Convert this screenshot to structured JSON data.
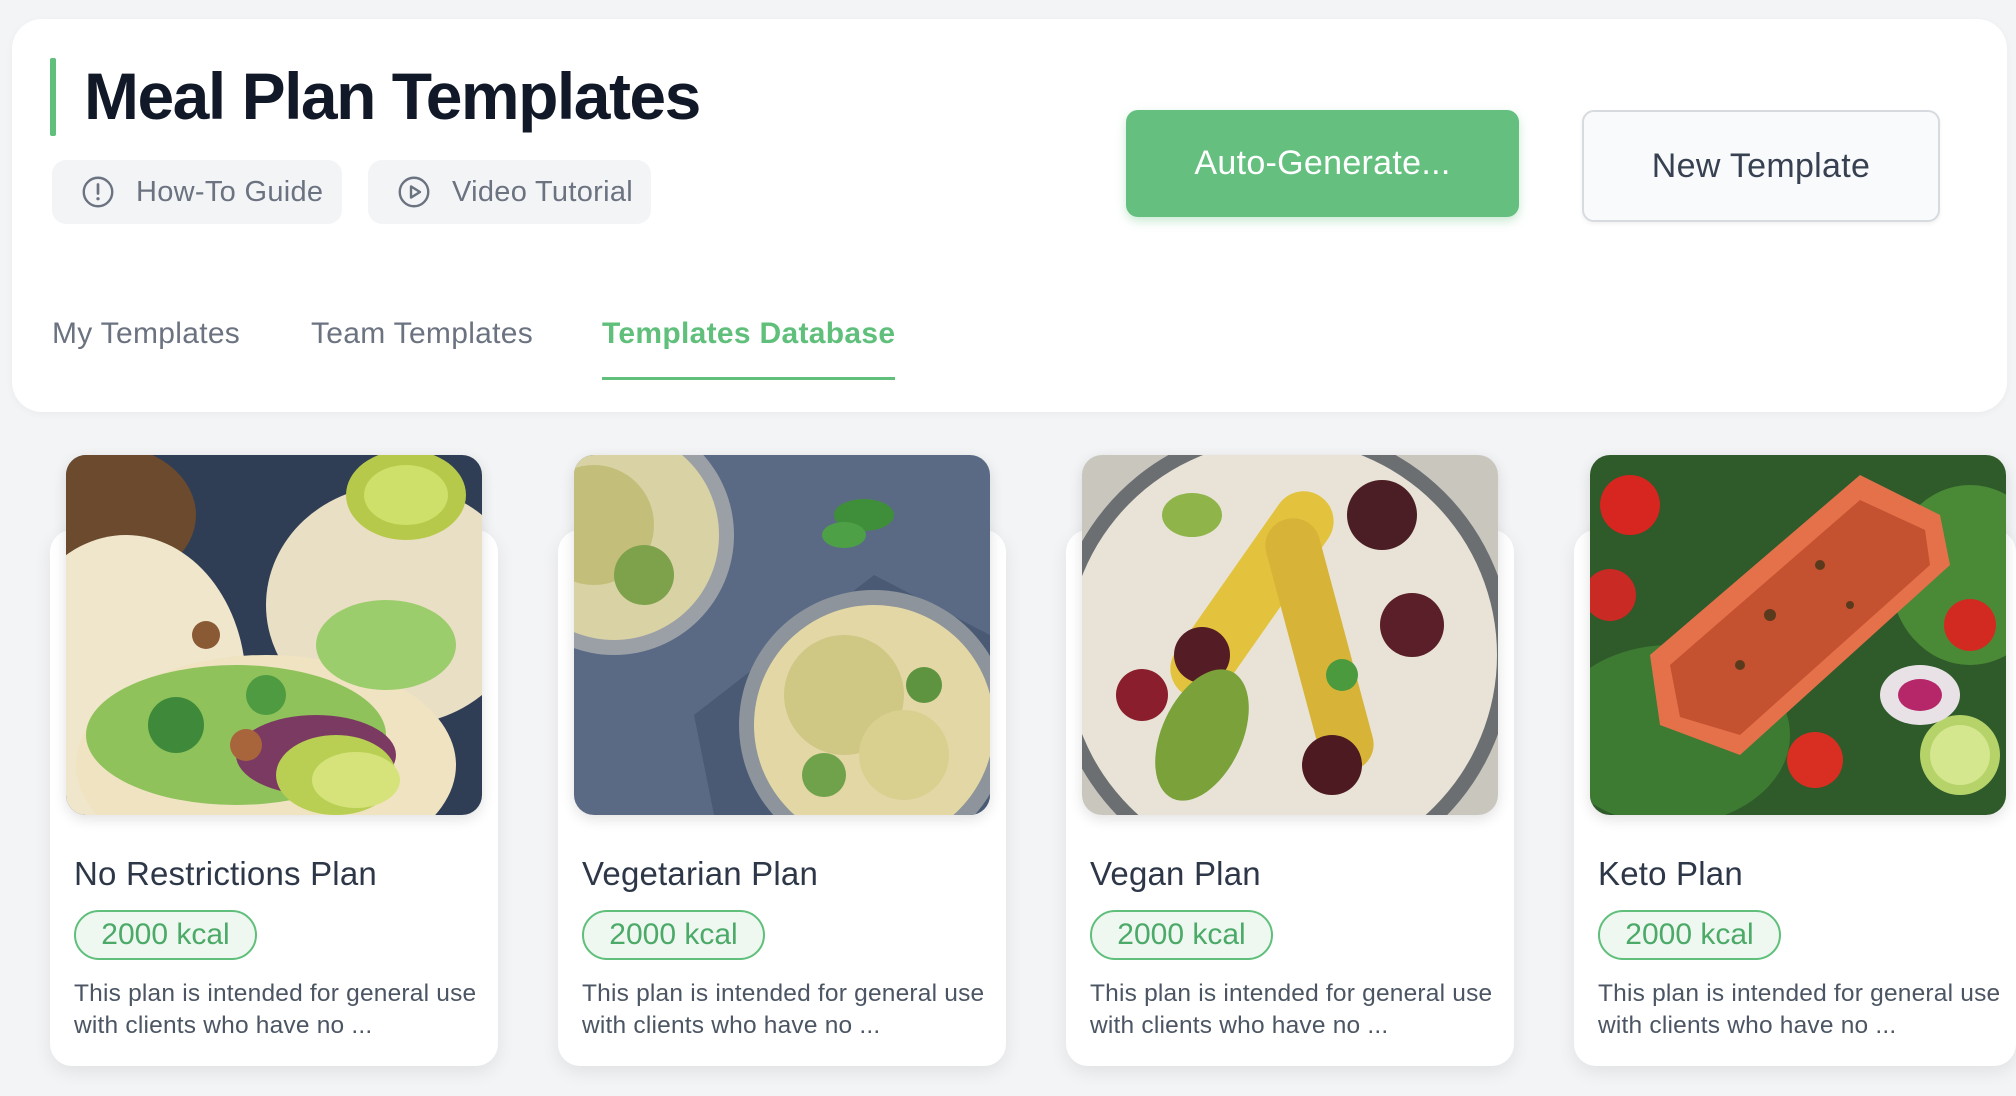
{
  "header": {
    "title": "Meal Plan Templates",
    "guide_label": "How-To Guide",
    "video_label": "Video Tutorial",
    "auto_generate_label": "Auto-Generate...",
    "new_template_label": "New Template",
    "accent_color": "#5fbf7b"
  },
  "tabs": [
    {
      "label": "My Templates",
      "active": false
    },
    {
      "label": "Team Templates",
      "active": false
    },
    {
      "label": "Templates Database",
      "active": true
    }
  ],
  "cards": [
    {
      "title": "No Restrictions Plan",
      "kcal": "2000 kcal",
      "description": "This plan is intended for general use with clients who have no ...",
      "image": "tacos-photo"
    },
    {
      "title": "Vegetarian Plan",
      "kcal": "2000 kcal",
      "description": "This plan is intended for general use with clients who have no ...",
      "image": "pasta-salad-photo"
    },
    {
      "title": "Vegan Plan",
      "kcal": "2000 kcal",
      "description": "This plan is intended for general use with clients who have no ...",
      "image": "corn-bowl-photo"
    },
    {
      "title": "Keto Plan",
      "kcal": "2000 kcal",
      "description": "This plan is intended for general use with clients who have no ...",
      "image": "salmon-salad-photo"
    }
  ]
}
